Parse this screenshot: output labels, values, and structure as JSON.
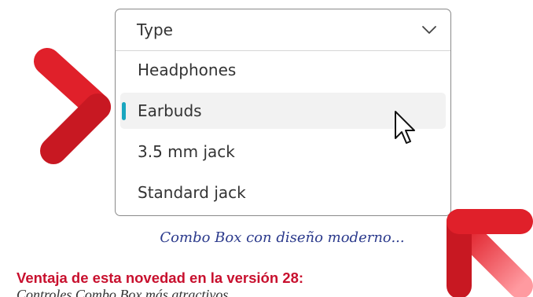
{
  "combo_box": {
    "header_label": "Type",
    "options": [
      {
        "label": "Headphones",
        "selected": false
      },
      {
        "label": "Earbuds",
        "selected": true
      },
      {
        "label": "3.5 mm jack",
        "selected": false
      },
      {
        "label": "Standard jack",
        "selected": false
      }
    ],
    "accent_color": "#19a6bf"
  },
  "caption": "Combo Box con diseño moderno...",
  "advantage": {
    "title": "Ventaja de esta novedad en la versión 28:",
    "text": "Controles Combo Box más atractivos..."
  },
  "colors": {
    "annotation_arrow": "#e0202a",
    "caption_text": "#2b3a8c",
    "advantage_title": "#c8102e"
  },
  "icons": {
    "chevron": "chevron-down-icon",
    "cursor": "mouse-pointer-icon",
    "annotation": "annotation-arrow-icon"
  }
}
